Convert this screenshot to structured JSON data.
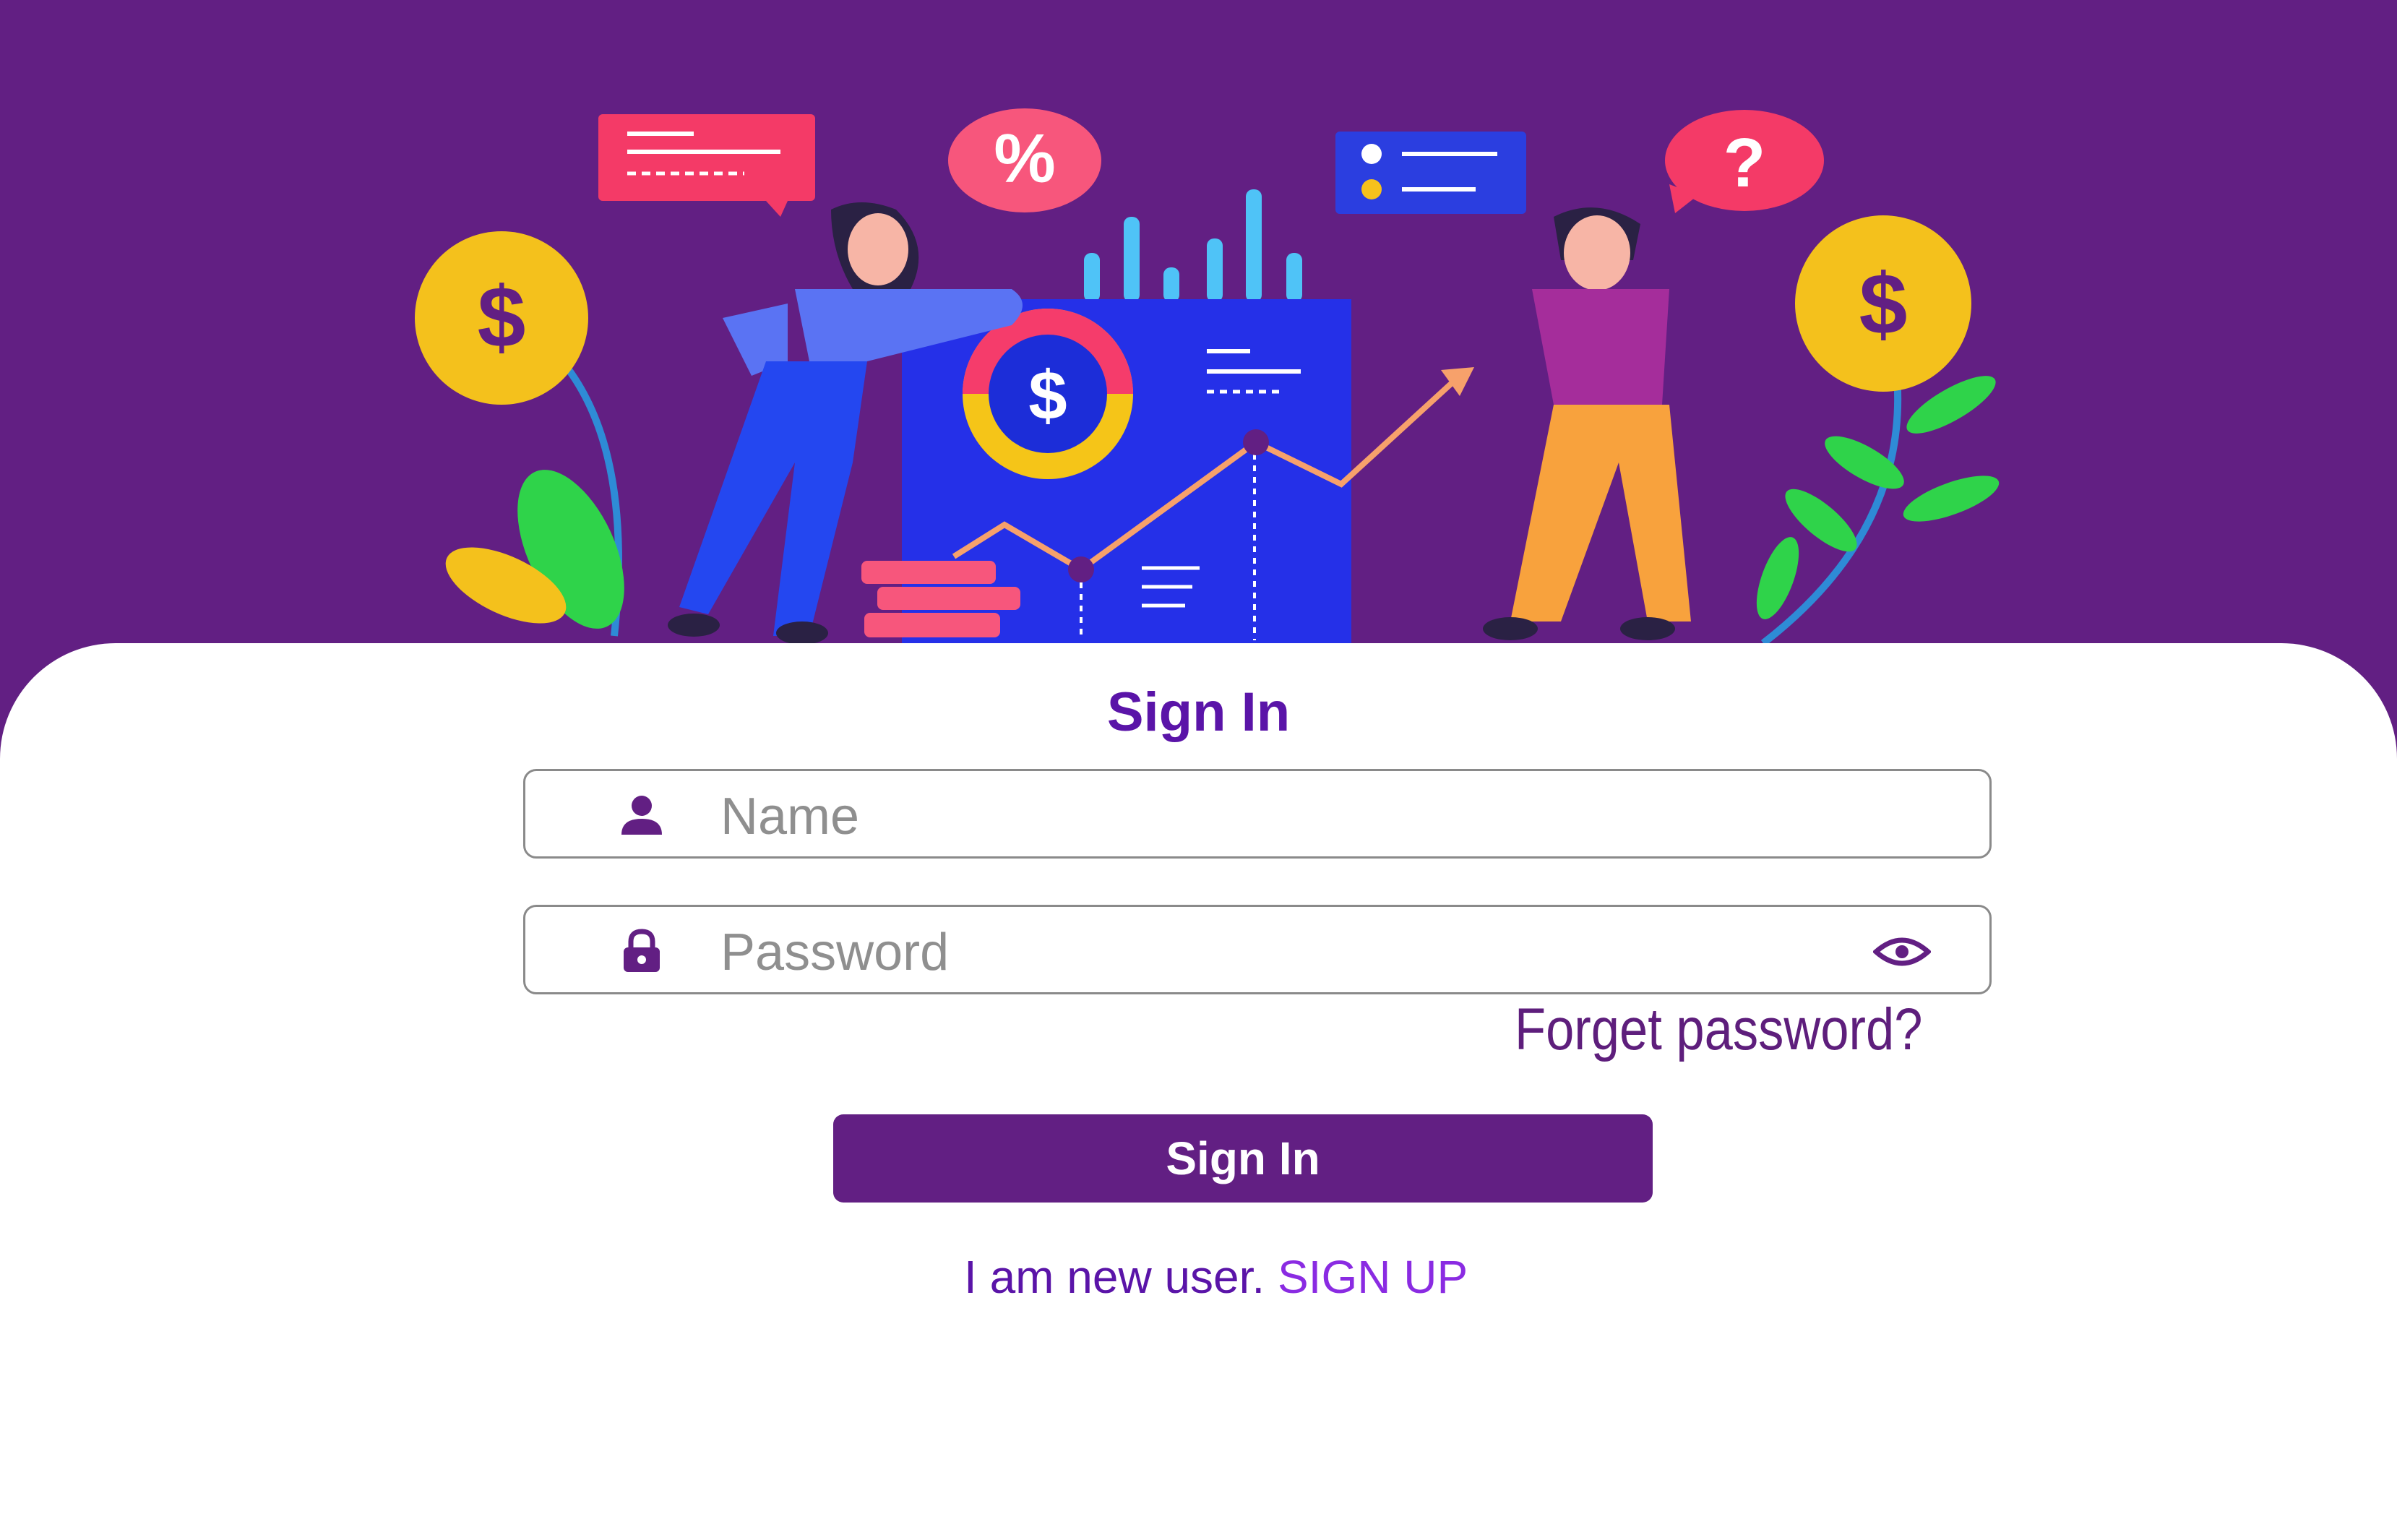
{
  "form": {
    "title": "Sign In",
    "name_placeholder": "Name",
    "password_placeholder": "Password",
    "forgot_label": "Forget password?",
    "submit_label": "Sign In",
    "new_user_text": "I am new user.",
    "signup_label": "SIGN UP"
  },
  "hero": {
    "percent_badge": "%",
    "question_badge": "?",
    "dollar_symbol": "$"
  },
  "colors": {
    "brand_purple": "#621f83",
    "title_purple": "#5a14a8",
    "link_purple": "#8a2be2",
    "placeholder_gray": "#8f8f8f"
  },
  "icons": {
    "name_field": "user-icon",
    "password_field": "lock-icon",
    "password_toggle": "eye-icon"
  }
}
